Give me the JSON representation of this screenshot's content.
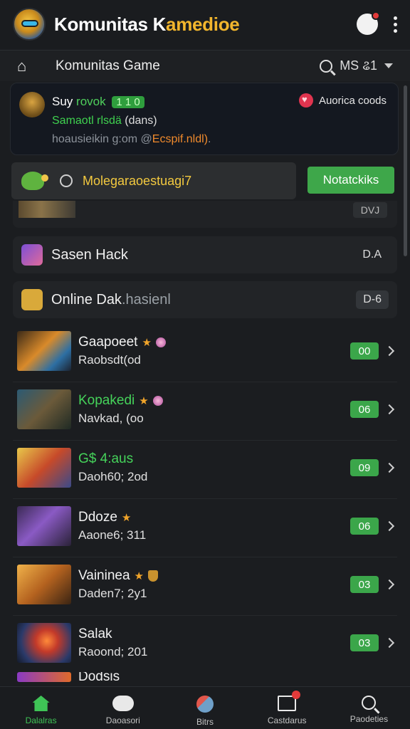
{
  "app": {
    "title_main": "Komunitas K",
    "title_accent": "amedioe"
  },
  "subbar": {
    "title": "Komunitas Game",
    "right_label": "MS ଌ1"
  },
  "user_card": {
    "line1_name": "Suy",
    "line1_green": "rovok",
    "line1_badge": "1 1 0",
    "line2_green": "Samaotl rlsdä",
    "line2_white": "(dans)",
    "line3_grey": "hoausieikin g:om @",
    "line3_orange": "Ecspif.nldl)",
    "line3_end": ".",
    "right_label": "Auorica coods"
  },
  "notif": {
    "text": "Molegaraoestuagi7",
    "button_label": "Notatckiks"
  },
  "partial_row": {
    "code": "DVJ"
  },
  "menu": [
    {
      "label": "Sasen Hack",
      "label_dim": "",
      "code": "D.A"
    },
    {
      "label": "Online Dak",
      "label_dim": ".hasienl",
      "code": "D-6"
    }
  ],
  "games": [
    {
      "name": "Gaapoeet",
      "sub": "Raobsdt(od",
      "badge": "00",
      "green": false,
      "icons": "star-gem"
    },
    {
      "name": "Kopakedi",
      "sub": "Navkad, (oo",
      "badge": "06",
      "green": true,
      "icons": "star-gem"
    },
    {
      "name": "G$ 4:aus",
      "sub": "Daoh60; 2od",
      "badge": "09",
      "green": true,
      "icons": ""
    },
    {
      "name": "Ddoze",
      "sub": "Aaone6; 311",
      "badge": "06",
      "green": false,
      "icons": "star"
    },
    {
      "name": "Vaininea",
      "sub": "Daden7; 2y1",
      "badge": "03",
      "green": false,
      "icons": "star-shield"
    },
    {
      "name": "Salak",
      "sub": "Raoond; 201",
      "badge": "03",
      "green": false,
      "icons": ""
    }
  ],
  "peek_row": {
    "name": "Dodsis"
  },
  "bottom_nav": [
    {
      "label": "Dalalras",
      "icon": "home-icon",
      "active": true
    },
    {
      "label": "Daoasori",
      "icon": "gamepad-icon",
      "active": false
    },
    {
      "label": "Bitrs",
      "icon": "people-icon",
      "active": false
    },
    {
      "label": "Castdarus",
      "icon": "box-icon",
      "active": false
    },
    {
      "label": "Paodeties",
      "icon": "search-icon",
      "active": false
    }
  ],
  "colors": {
    "accent_green": "#3ea74a",
    "accent_gold": "#f1b52d",
    "background": "#1b1d20"
  }
}
